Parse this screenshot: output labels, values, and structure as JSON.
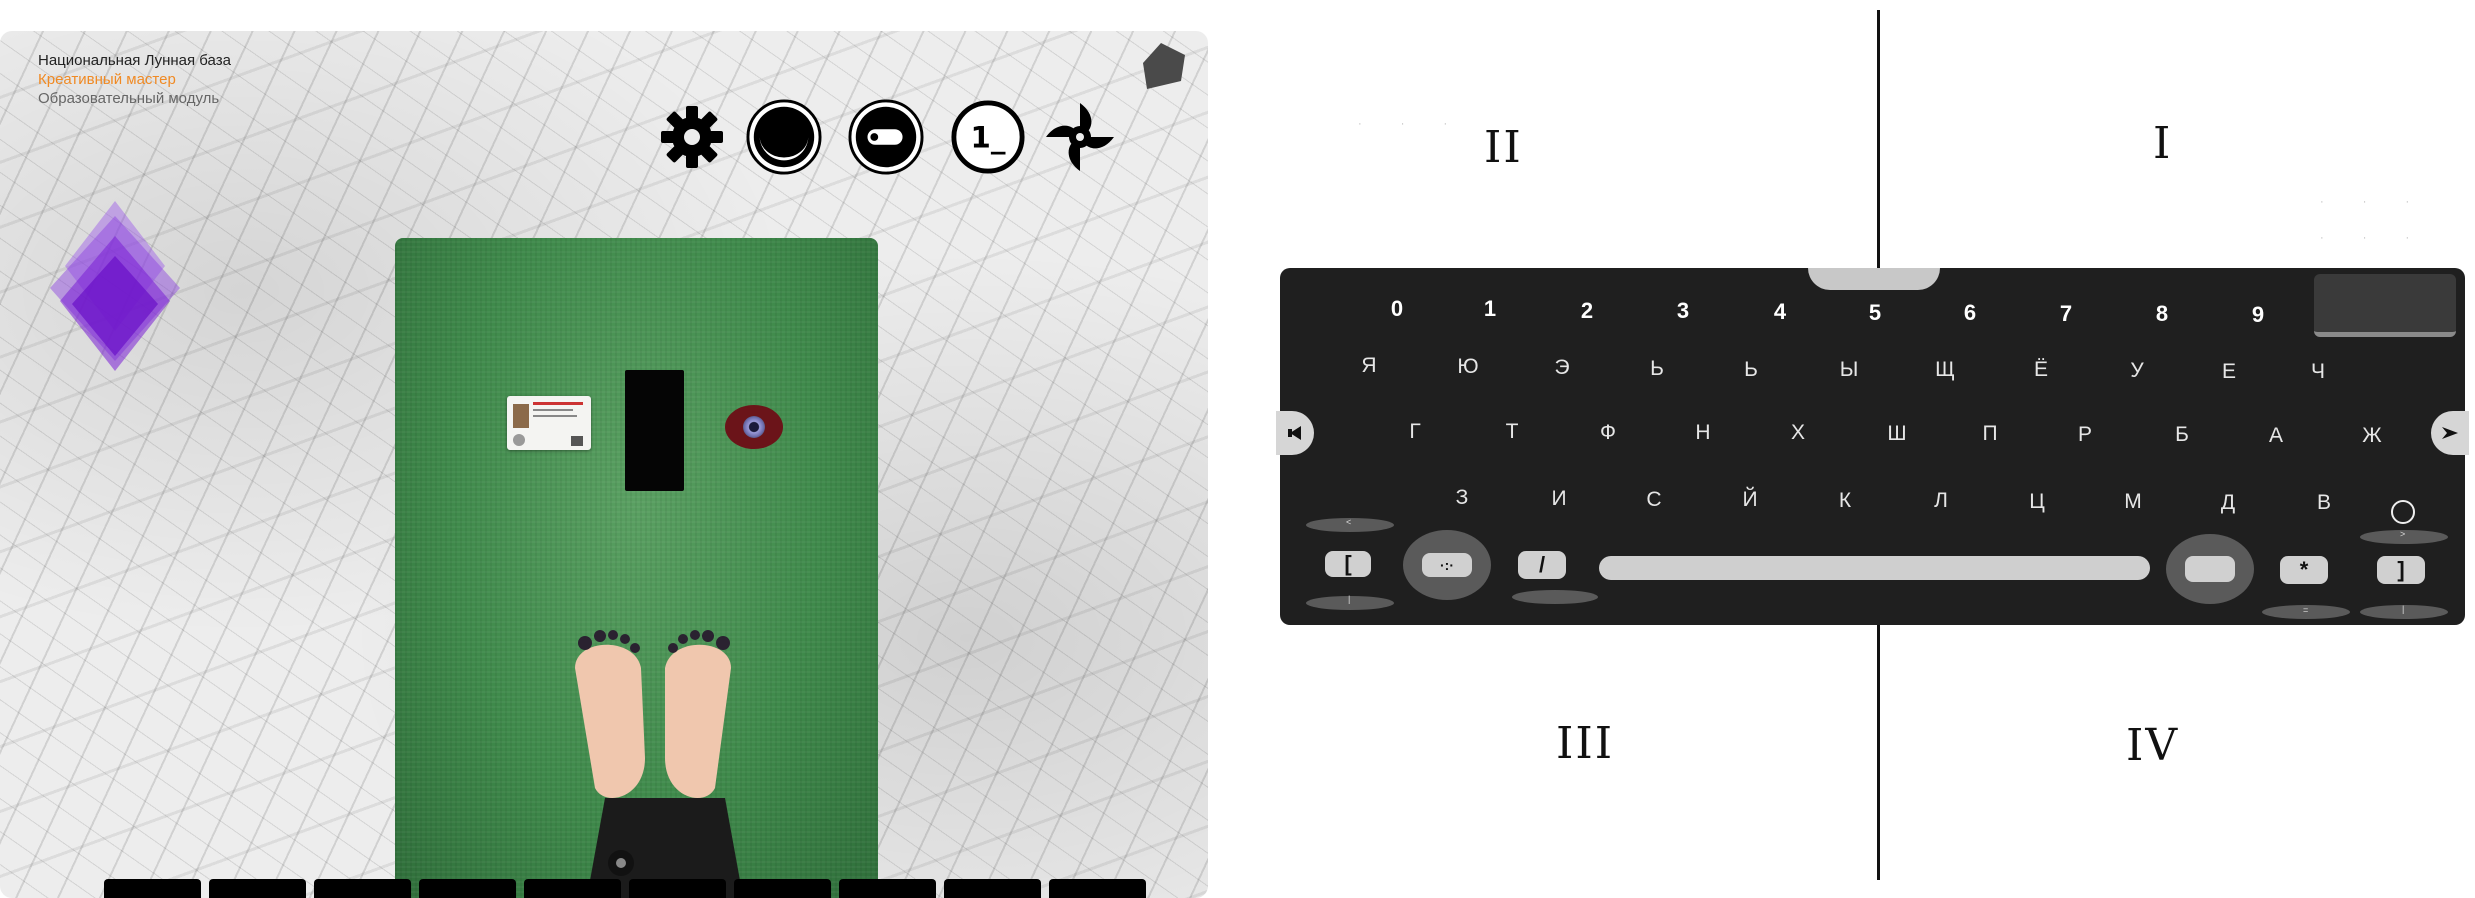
{
  "brand": {
    "line1": "Национальная Лунная база",
    "line2": "Креативный мастер",
    "line3": "Образовательный модуль"
  },
  "toolbar": {
    "icons": [
      "gear-icon",
      "smile-arc-icon",
      "capsule-icon",
      "terminal-one-icon",
      "shuriken-icon"
    ],
    "terminal_label": "1_"
  },
  "bottom_bar": {
    "slot_count": 10
  },
  "quadrants": {
    "q1": "I",
    "q2": "II",
    "q3": "III",
    "q4": "IV"
  },
  "keyboard": {
    "digits": [
      "0",
      "1",
      "2",
      "3",
      "4",
      "5",
      "6",
      "7",
      "8",
      "9"
    ],
    "row1": [
      "Я",
      "Ю",
      "Э",
      "Ь",
      "Ь",
      "Ы",
      "Щ",
      "Ё",
      "У",
      "Е",
      "Ч"
    ],
    "row2": [
      "Г",
      "Т",
      "Ф",
      "Н",
      "Х",
      "Ш",
      "П",
      "Р",
      "Б",
      "А",
      "Ж"
    ],
    "row3": [
      "З",
      "И",
      "С",
      "Й",
      "К",
      "Л",
      "Ц",
      "М",
      "Д",
      "В"
    ],
    "bracket_open": "[",
    "bracket_close": "]",
    "slash": "/",
    "asterisk": "*",
    "left_up": "<",
    "right_up": ">",
    "left_down": "|",
    "right_down": "|",
    "equals": "="
  },
  "colors": {
    "brand_accent": "#f08a24",
    "keyboard_bg": "#1f1f1f",
    "mat_green": "#3f8a4b",
    "diamond_purple": "#7a1fd6"
  }
}
